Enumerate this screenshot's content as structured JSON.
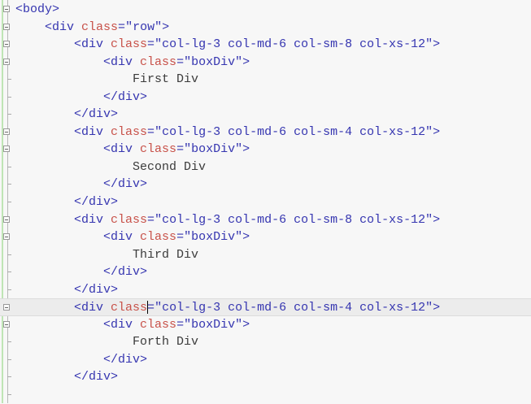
{
  "editor": {
    "language": "html",
    "current_line": 17,
    "lines": [
      {
        "indent": 0,
        "fold": true,
        "tokens": [
          [
            "t",
            "<body>"
          ]
        ]
      },
      {
        "indent": 1,
        "fold": true,
        "tokens": [
          [
            "t",
            "<div "
          ],
          [
            "a",
            "class"
          ],
          [
            "t",
            "="
          ],
          [
            "v",
            "\"row\""
          ],
          [
            "t",
            ">"
          ]
        ]
      },
      {
        "indent": 2,
        "fold": true,
        "tokens": [
          [
            "t",
            "<div "
          ],
          [
            "a",
            "class"
          ],
          [
            "t",
            "="
          ],
          [
            "v",
            "\"col-lg-3 col-md-6 col-sm-8 col-xs-12\""
          ],
          [
            "t",
            ">"
          ]
        ]
      },
      {
        "indent": 3,
        "fold": true,
        "tokens": [
          [
            "t",
            "<div "
          ],
          [
            "a",
            "class"
          ],
          [
            "t",
            "="
          ],
          [
            "v",
            "\"boxDiv\""
          ],
          [
            "t",
            ">"
          ]
        ]
      },
      {
        "indent": 4,
        "fold": false,
        "tokens": [
          [
            "x",
            "First Div"
          ]
        ]
      },
      {
        "indent": 3,
        "fold": false,
        "tokens": [
          [
            "t",
            "</div>"
          ]
        ]
      },
      {
        "indent": 2,
        "fold": false,
        "tokens": [
          [
            "t",
            "</div>"
          ]
        ]
      },
      {
        "indent": 2,
        "fold": true,
        "tokens": [
          [
            "t",
            "<div "
          ],
          [
            "a",
            "class"
          ],
          [
            "t",
            "="
          ],
          [
            "v",
            "\"col-lg-3 col-md-6 col-sm-4 col-xs-12\""
          ],
          [
            "t",
            ">"
          ]
        ]
      },
      {
        "indent": 3,
        "fold": true,
        "tokens": [
          [
            "t",
            "<div "
          ],
          [
            "a",
            "class"
          ],
          [
            "t",
            "="
          ],
          [
            "v",
            "\"boxDiv\""
          ],
          [
            "t",
            ">"
          ]
        ]
      },
      {
        "indent": 4,
        "fold": false,
        "tokens": [
          [
            "x",
            "Second Div"
          ]
        ]
      },
      {
        "indent": 3,
        "fold": false,
        "tokens": [
          [
            "t",
            "</div>"
          ]
        ]
      },
      {
        "indent": 2,
        "fold": false,
        "tokens": [
          [
            "t",
            "</div>"
          ]
        ]
      },
      {
        "indent": 2,
        "fold": true,
        "tokens": [
          [
            "t",
            "<div "
          ],
          [
            "a",
            "class"
          ],
          [
            "t",
            "="
          ],
          [
            "v",
            "\"col-lg-3 col-md-6 col-sm-8 col-xs-12\""
          ],
          [
            "t",
            ">"
          ]
        ]
      },
      {
        "indent": 3,
        "fold": true,
        "tokens": [
          [
            "t",
            "<div "
          ],
          [
            "a",
            "class"
          ],
          [
            "t",
            "="
          ],
          [
            "v",
            "\"boxDiv\""
          ],
          [
            "t",
            ">"
          ]
        ]
      },
      {
        "indent": 4,
        "fold": false,
        "tokens": [
          [
            "x",
            "Third Div"
          ]
        ]
      },
      {
        "indent": 3,
        "fold": false,
        "tokens": [
          [
            "t",
            "</div>"
          ]
        ]
      },
      {
        "indent": 2,
        "fold": false,
        "tokens": [
          [
            "t",
            "</div>"
          ]
        ]
      },
      {
        "indent": 2,
        "fold": true,
        "caret_after_token": 1,
        "tokens": [
          [
            "t",
            "<div "
          ],
          [
            "a",
            "class"
          ],
          [
            "t",
            "="
          ],
          [
            "v",
            "\"col-lg-3 col-md-6 col-sm-4 col-xs-12\""
          ],
          [
            "t",
            ">"
          ]
        ]
      },
      {
        "indent": 3,
        "fold": true,
        "tokens": [
          [
            "t",
            "<div "
          ],
          [
            "a",
            "class"
          ],
          [
            "t",
            "="
          ],
          [
            "v",
            "\"boxDiv\""
          ],
          [
            "t",
            ">"
          ]
        ]
      },
      {
        "indent": 4,
        "fold": false,
        "tokens": [
          [
            "x",
            "Forth Div"
          ]
        ]
      },
      {
        "indent": 3,
        "fold": false,
        "tokens": [
          [
            "t",
            "</div>"
          ]
        ]
      },
      {
        "indent": 2,
        "fold": false,
        "tokens": [
          [
            "t",
            "</div>"
          ]
        ]
      },
      {
        "indent": 0,
        "fold": false,
        "tokens": []
      }
    ]
  }
}
